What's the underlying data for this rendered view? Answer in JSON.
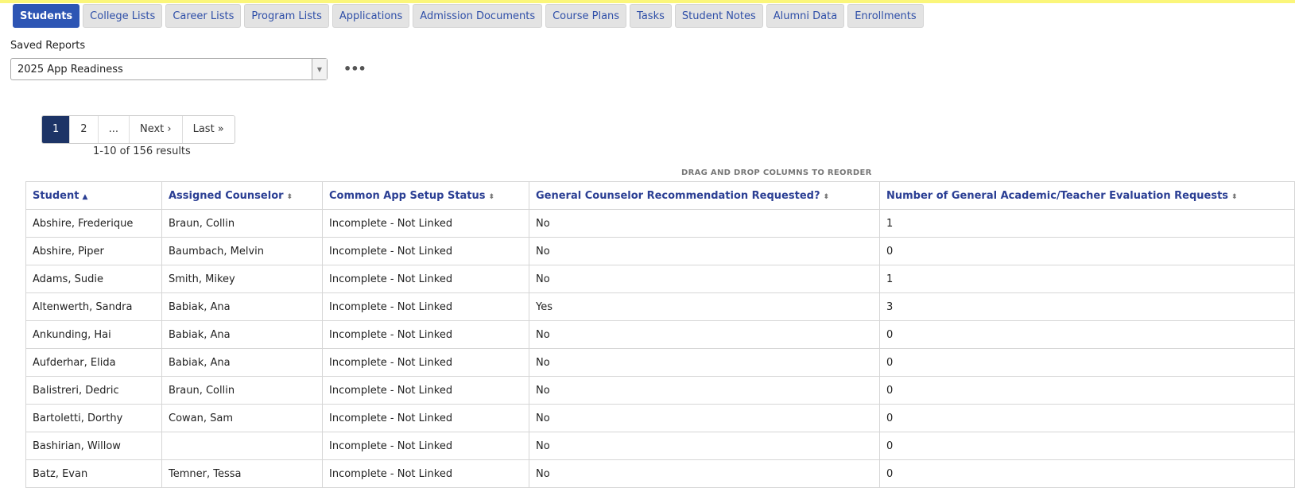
{
  "tabs": [
    {
      "label": "Students",
      "active": true
    },
    {
      "label": "College Lists"
    },
    {
      "label": "Career Lists"
    },
    {
      "label": "Program Lists"
    },
    {
      "label": "Applications"
    },
    {
      "label": "Admission Documents"
    },
    {
      "label": "Course Plans"
    },
    {
      "label": "Tasks"
    },
    {
      "label": "Student Notes"
    },
    {
      "label": "Alumni Data"
    },
    {
      "label": "Enrollments"
    }
  ],
  "saved_reports": {
    "label": "Saved Reports",
    "selected": "2025 App Readiness"
  },
  "pagination": {
    "pages": [
      "1",
      "2",
      "...",
      "Next ›",
      "Last »"
    ],
    "current": "1",
    "results_text": "1-10 of 156 results"
  },
  "drag_hint": "DRAG AND DROP COLUMNS TO REORDER",
  "table": {
    "columns": [
      {
        "label": "Student",
        "sort": "asc"
      },
      {
        "label": "Assigned Counselor",
        "sort": "none"
      },
      {
        "label": "Common App Setup Status",
        "sort": "none"
      },
      {
        "label": "General Counselor Recommendation Requested?",
        "sort": "none"
      },
      {
        "label": "Number of General Academic/Teacher Evaluation Requests",
        "sort": "none"
      }
    ],
    "rows": [
      [
        "Abshire, Frederique",
        "Braun, Collin",
        "Incomplete - Not Linked",
        "No",
        "1"
      ],
      [
        "Abshire, Piper",
        "Baumbach, Melvin",
        "Incomplete - Not Linked",
        "No",
        "0"
      ],
      [
        "Adams, Sudie",
        "Smith, Mikey",
        "Incomplete - Not Linked",
        "No",
        "1"
      ],
      [
        "Altenwerth, Sandra",
        "Babiak, Ana",
        "Incomplete - Not Linked",
        "Yes",
        "3"
      ],
      [
        "Ankunding, Hai",
        "Babiak, Ana",
        "Incomplete - Not Linked",
        "No",
        "0"
      ],
      [
        "Aufderhar, Elida",
        "Babiak, Ana",
        "Incomplete - Not Linked",
        "No",
        "0"
      ],
      [
        "Balistreri, Dedric",
        "Braun, Collin",
        "Incomplete - Not Linked",
        "No",
        "0"
      ],
      [
        "Bartoletti, Dorthy",
        "Cowan, Sam",
        "Incomplete - Not Linked",
        "No",
        "0"
      ],
      [
        "Bashirian, Willow",
        "",
        "Incomplete - Not Linked",
        "No",
        "0"
      ],
      [
        "Batz, Evan",
        "Temner, Tessa",
        "Incomplete - Not Linked",
        "No",
        "0"
      ]
    ]
  },
  "colors": {
    "accent": "#2d55b4",
    "pager_active": "#1d3466",
    "link": "#2b3f94",
    "top_stripe": "#fbf67a"
  }
}
